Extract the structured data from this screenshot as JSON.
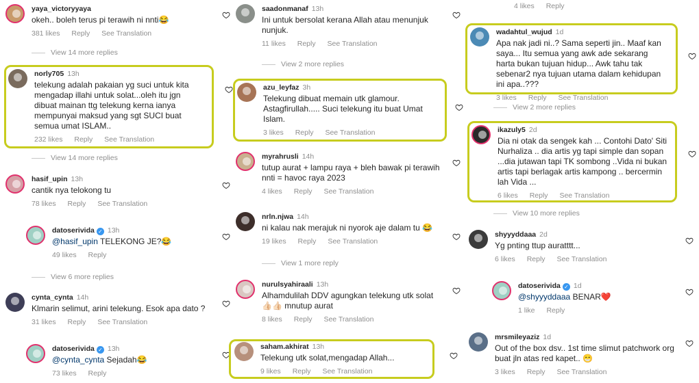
{
  "col1": {
    "c1": {
      "user": "yaya_victoryyaya",
      "text": "okeh.. boleh terus pi terawih ni nnti😂",
      "likes": "381 likes",
      "reply": "Reply",
      "see": "See Translation"
    },
    "r1": "View 14 more replies",
    "c2": {
      "user": "norly705",
      "time": "13h",
      "text": "telekung adalah pakaian yg suci untuk kita mengadap illahi untuk solat...oleh itu jgn dibuat mainan ttg telekung kerna ianya mempunyai maksud yang sgt SUCI buat semua umat ISLAM..",
      "likes": "232 likes",
      "reply": "Reply",
      "see": "See Translation"
    },
    "r2": "View 14 more replies",
    "c3": {
      "user": "hasif_upin",
      "time": "13h",
      "text": "cantik nya telokong tu",
      "likes": "78 likes",
      "reply": "Reply",
      "see": "See Translation"
    },
    "c4": {
      "user": "datoserivida",
      "time": "13h",
      "mention": "@hasif_upin",
      "text": " TELEKONG JE?😂",
      "likes": "49 likes",
      "reply": "Reply"
    },
    "r3": "View 6 more replies",
    "c5": {
      "user": "cynta_cynta",
      "time": "14h",
      "text": "Klmarin selimut, arini telekung. Esok apa dato ?",
      "likes": "31 likes",
      "reply": "Reply",
      "see": "See Translation"
    },
    "c6": {
      "user": "datoserivida",
      "time": "13h",
      "mention": "@cynta_cynta",
      "text": " Sejadah😂",
      "likes": "73 likes",
      "reply": "Reply"
    }
  },
  "col2": {
    "c1": {
      "user": "saadonmanaf",
      "time": "13h",
      "text": "Ini untuk bersolat kerana Allah atau menunjuk nunjuk.",
      "likes": "11 likes",
      "reply": "Reply",
      "see": "See Translation"
    },
    "r1": "View 2 more replies",
    "c2": {
      "user": "azu_leyfaz",
      "time": "3h",
      "text": "Telekung dibuat memain utk glamour. Astagfirullah..... Suci telekung itu buat Umat Islam.",
      "likes": "3 likes",
      "reply": "Reply",
      "see": "See Translation"
    },
    "c3": {
      "user": "myrahrusli",
      "time": "14h",
      "text": "tutup aurat + lampu raya + bleh bawak pi terawih nnti = havoc raya 2023",
      "likes": "4 likes",
      "reply": "Reply",
      "see": "See Translation"
    },
    "c4": {
      "user": "nrln.njwa",
      "time": "14h",
      "text": "ni kalau nak merajuk ni nyorok aje dalam tu 😂",
      "likes": "19 likes",
      "reply": "Reply",
      "see": "See Translation"
    },
    "r2": "View 1 more reply",
    "c5": {
      "user": "nurulsyahiraali",
      "time": "13h",
      "text": "Alhamdulilah DDV agungkan telekung utk solat 👍🏻👍🏻 mnutup aurat",
      "likes": "8 likes",
      "reply": "Reply",
      "see": "See Translation"
    },
    "c6": {
      "user": "saham.akhirat",
      "time": "13h",
      "text": "Telekung utk solat,mengadap Allah...",
      "likes": "9 likes",
      "reply": "Reply",
      "see": "See Translation"
    }
  },
  "col3": {
    "top": {
      "likes": "4 likes",
      "reply": "Reply"
    },
    "c1": {
      "user": "wadahtul_wujud",
      "time": "1d",
      "text": "Apa nak jadi ni..? Sama seperti jin.. Maaf kan saya... Itu semua yang awk ade sekarang harta bukan tujuan hidup... Awk tahu tak sebenar2 nya tujuan utama dalam kehidupan ini apa..???",
      "likes": "3 likes",
      "reply": "Reply",
      "see": "See Translation"
    },
    "r1": "View 2 more replies",
    "c2": {
      "user": "ikazuly5",
      "time": "2d",
      "text": "Dia ni otak da sengek kah ... Contohi Dato' Siti Nurhaliza .. dia artis yg tapi simple dan sopan ...dia jutawan  tapi TK sombong ..Vida ni bukan artis tapi berlagak artis kampong .. bercermin lah Vida ...",
      "likes": "6 likes",
      "reply": "Reply",
      "see": "See Translation"
    },
    "r2": "View 10 more replies",
    "c3": {
      "user": "shyyyddaaa",
      "time": "2d",
      "text": "Yg pnting ttup auratttt...",
      "likes": "6 likes",
      "reply": "Reply",
      "see": "See Translation"
    },
    "c4": {
      "user": "datoserivida",
      "time": "1d",
      "mention": "@shyyyddaaa",
      "text": " BENAR❤️",
      "likes": "1 like",
      "reply": "Reply"
    },
    "c5": {
      "user": "mrsmileyaziz",
      "time": "1d",
      "text": "Out of the box dsv.. 1st time slimut patchwork org buat jln atas red kapet.. 😁",
      "likes": "3 likes",
      "reply": "Reply",
      "see": "See Translation"
    }
  },
  "colors": {
    "highlight": "#c7cc1e",
    "verified": "#3897f0",
    "mention": "#00376b",
    "meta": "#8e8e8e"
  }
}
